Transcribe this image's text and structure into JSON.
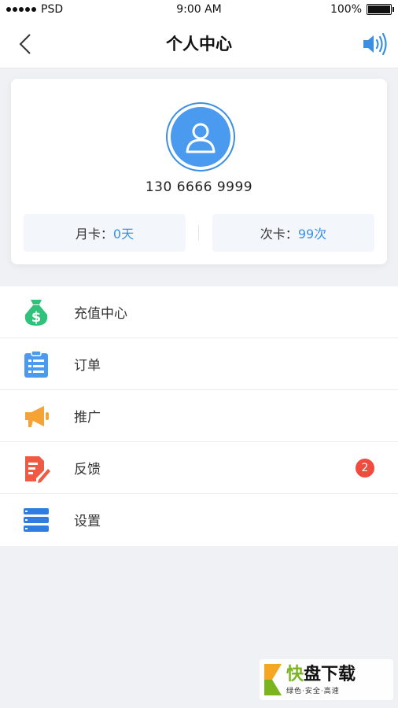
{
  "status_bar": {
    "carrier": "PSD",
    "time": "9:00 AM",
    "battery": "100%"
  },
  "nav": {
    "title": "个人中心",
    "back_icon": "chevron-left-icon",
    "speaker_icon": "speaker-volume-icon"
  },
  "profile": {
    "phone": "130 6666 9999",
    "month_card": {
      "label": "月卡：",
      "value": "0天"
    },
    "count_card": {
      "label": "次卡：",
      "value": "99次"
    }
  },
  "menu": [
    {
      "label": "充值中心",
      "icon": "money-bag-icon",
      "color": "#2fc27a"
    },
    {
      "label": "订单",
      "icon": "clipboard-list-icon",
      "color": "#4a9af0"
    },
    {
      "label": "推广",
      "icon": "megaphone-icon",
      "color": "#f5a236"
    },
    {
      "label": "反馈",
      "icon": "feedback-edit-icon",
      "color": "#ef5a45",
      "badge": "2"
    },
    {
      "label": "设置",
      "icon": "settings-bars-icon",
      "color": "#2f7de0"
    }
  ],
  "watermark": {
    "title_part1": "快",
    "title_part2": "盘下载",
    "subtitle": "绿色·安全·高速"
  },
  "colors": {
    "accent": "#3a8fe3",
    "badge": "#ef4b3f",
    "background": "#f0f1f4"
  }
}
